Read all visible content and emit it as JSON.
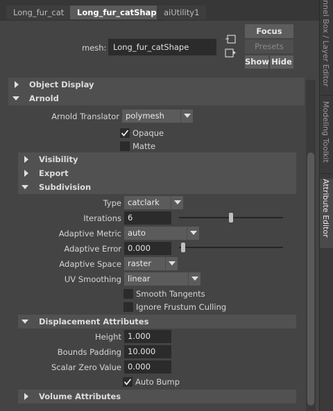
{
  "tabs": [
    "Long_fur_cat",
    "Long_fur_catShape",
    "aiUtility1"
  ],
  "dock_tabs": {
    "channel_box": "nnel Box / Layer Editor",
    "modeling_toolkit": "Modeling Toolkit",
    "attribute_editor": "Attribute Editor"
  },
  "mesh": {
    "label": "mesh:",
    "value": "Long_fur_catShape"
  },
  "buttons": {
    "focus": "Focus",
    "presets": "Presets",
    "show": "Show",
    "hide": "Hide"
  },
  "frames": {
    "object_display": "Object Display",
    "arnold": "Arnold",
    "visibility": "Visibility",
    "export": "Export",
    "subdivision": "Subdivision",
    "displacement": "Displacement Attributes",
    "volume": "Volume Attributes"
  },
  "arnold": {
    "translator_label": "Arnold Translator",
    "translator_value": "polymesh",
    "opaque_label": "Opaque",
    "opaque_checked": true,
    "matte_label": "Matte",
    "matte_checked": false
  },
  "subdivision": {
    "type_label": "Type",
    "type_value": "catclark",
    "iterations_label": "Iterations",
    "iterations_value": "6",
    "iterations_slider": 0.5,
    "adaptive_metric_label": "Adaptive Metric",
    "adaptive_metric_value": "auto",
    "adaptive_error_label": "Adaptive Error",
    "adaptive_error_value": "0.000",
    "adaptive_error_slider": 0.0,
    "adaptive_space_label": "Adaptive Space",
    "adaptive_space_value": "raster",
    "uv_smoothing_label": "UV Smoothing",
    "uv_smoothing_value": "linear",
    "smooth_tangents_label": "Smooth Tangents",
    "smooth_tangents_checked": false,
    "ignore_frustum_label": "Ignore Frustum Culling",
    "ignore_frustum_checked": false
  },
  "displacement": {
    "height_label": "Height",
    "height_value": "1.000",
    "bounds_padding_label": "Bounds Padding",
    "bounds_padding_value": "10.000",
    "scalar_zero_label": "Scalar Zero Value",
    "scalar_zero_value": "0.000",
    "auto_bump_label": "Auto Bump",
    "auto_bump_checked": true
  },
  "colors": {
    "panel_bg": "#444444",
    "field_bg": "#2b2b2b",
    "frame_bar": "#4f4f4f",
    "button_bg": "#5d5d5d"
  }
}
